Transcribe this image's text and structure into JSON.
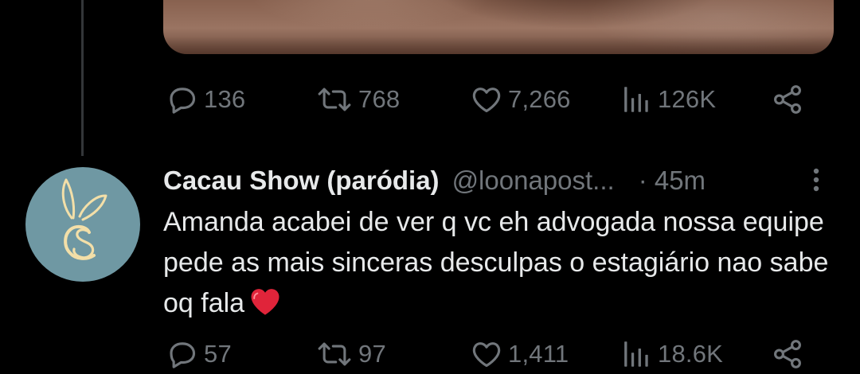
{
  "media": {
    "icon": "photo-thumbnail"
  },
  "tweet_above": {
    "replies": "136",
    "retweets": "768",
    "likes": "7,266",
    "views": "126K"
  },
  "tweet": {
    "display_name": "Cacau Show (paródia)",
    "handle": "@loonapost...",
    "time": "· 45m",
    "text": "Amanda acabei de ver q vc eh advogada nossa equipe pede as mais sinceras desculpas o estagiário nao sabe oq fala",
    "emoji": "red-heart-emoji",
    "avatar_icon": "bunny-cs-logo",
    "replies": "57",
    "retweets": "97",
    "likes": "1,411",
    "views": "18.6K"
  },
  "colors": {
    "background": "#000000",
    "text_primary": "#e7e9ea",
    "text_secondary": "#71767b",
    "thread_line": "#333639",
    "avatar_bg": "#6f98a3",
    "logo_color": "#f3dfa8",
    "heart_red": "#e0243a"
  }
}
